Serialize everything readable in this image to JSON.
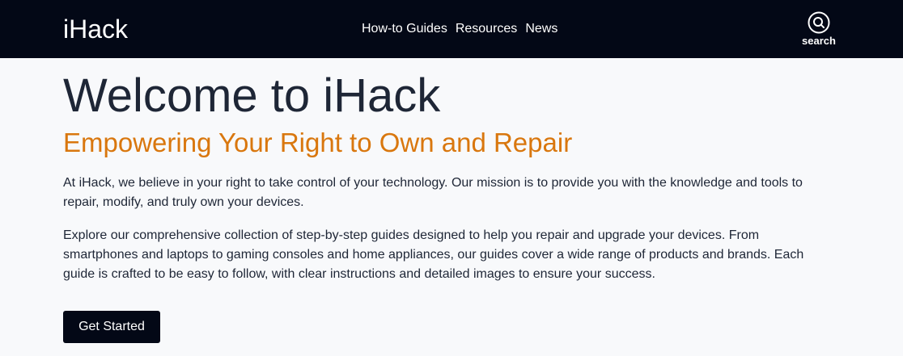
{
  "nav": {
    "logo": "iHack",
    "links": [
      {
        "label": "How-to Guides"
      },
      {
        "label": "Resources"
      },
      {
        "label": "News"
      }
    ],
    "search": {
      "label": "search",
      "icon": "search-icon"
    }
  },
  "hero": {
    "title": "Welcome to iHack",
    "subtitle": "Empowering Your Right to Own and Repair",
    "paragraphs": [
      "At iHack, we believe in your right to take control of your technology. Our mission is to provide you with the knowledge and tools to repair, modify, and truly own your devices.",
      "Explore our comprehensive collection of step-by-step guides designed to help you repair and upgrade your devices. From smartphones and laptops to gaming consoles and home appliances, our guides cover a wide range of products and brands. Each guide is crafted to be easy to follow, with clear instructions and detailed images to ensure your success."
    ],
    "cta_label": "Get Started"
  },
  "colors": {
    "navbar_bg": "#030816",
    "accent": "#d9770e",
    "text": "#1e2636",
    "page_bg": "#f8f9fb"
  }
}
